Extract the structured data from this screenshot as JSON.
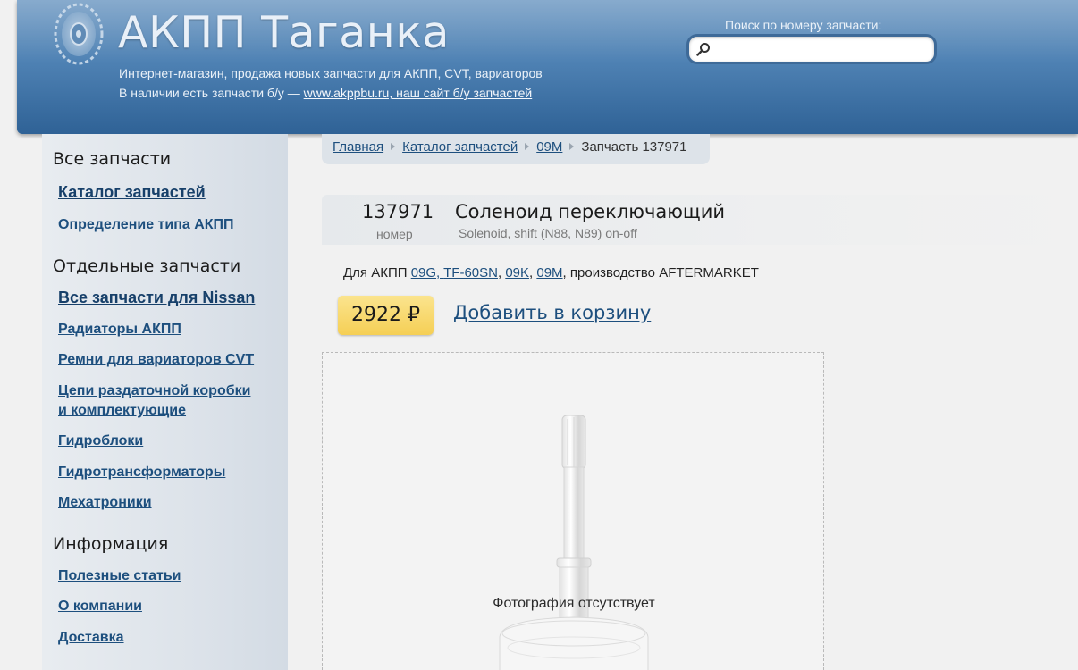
{
  "header": {
    "title": "АКПП Таганка",
    "tagline_1": "Интернет-магазин, продажа новых запчасти для АКПП, CVT, вариаторов",
    "tagline_2_prefix": "В наличии есть запчасти б/у — ",
    "tagline_2_link": "www.akppbu.ru, наш сайт б/у запчастей",
    "search_label": "Поиск по номеру запчасти:",
    "search_value": "",
    "search_placeholder": ""
  },
  "sidebar": {
    "sections": [
      {
        "heading": "Все запчасти",
        "items": [
          "Каталог запчастей",
          "Определение типа АКПП"
        ]
      },
      {
        "heading": "Отдельные запчасти",
        "items": [
          "Все запчасти для Nissan",
          "Радиаторы АКПП",
          "Ремни для вариаторов CVT",
          "Цепи раздаточной коробки",
          "и комплектующие",
          "Гидроблоки",
          "Гидротрансформаторы",
          "Мехатроники"
        ]
      },
      {
        "heading": "Информация",
        "items": [
          "Полезные статьи",
          "О компании",
          "Доставка"
        ]
      }
    ]
  },
  "breadcrumb": {
    "items": [
      "Главная",
      "Каталог запчастей",
      "09M"
    ],
    "current": "Запчасть 137971"
  },
  "part": {
    "number": "137971",
    "number_label": "номер",
    "name": "Соленоид переключающий",
    "subtitle": "Solenoid, shift (N88, N89) on-off",
    "for_prefix": "Для АКПП ",
    "transmissions": [
      "09G",
      "TF-60SN",
      "09K",
      "09M"
    ],
    "sep": ", ",
    "maker_text": ", производство AFTERMARKET",
    "price": "2922 ₽",
    "add_to_cart": "Добавить в корзину",
    "photo_caption": "Фотография отсутствует"
  },
  "colors": {
    "header_blue": "#4f82b4",
    "link_blue": "#1d4f7e",
    "price_yellow": "#f5cf55"
  }
}
